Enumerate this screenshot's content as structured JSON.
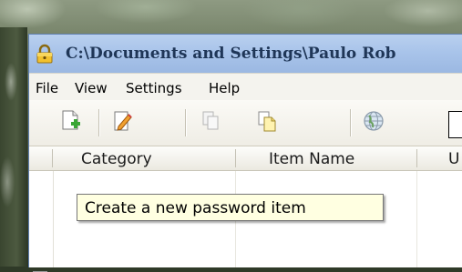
{
  "window": {
    "title": "C:\\Documents and Settings\\Paulo Rob",
    "title_icon": "padlock-icon"
  },
  "menu": {
    "items": [
      "File",
      "View",
      "Settings",
      "Help"
    ]
  },
  "toolbar": {
    "buttons": [
      {
        "icon": "new-item-icon"
      },
      {
        "icon": "edit-item-icon"
      },
      {
        "icon": "copy-icon"
      },
      {
        "icon": "paste-icon"
      },
      {
        "icon": "globe-icon"
      }
    ]
  },
  "table": {
    "columns": [
      "Category",
      "Item Name",
      "U"
    ]
  },
  "tooltip": {
    "text": "Create a new password item"
  }
}
